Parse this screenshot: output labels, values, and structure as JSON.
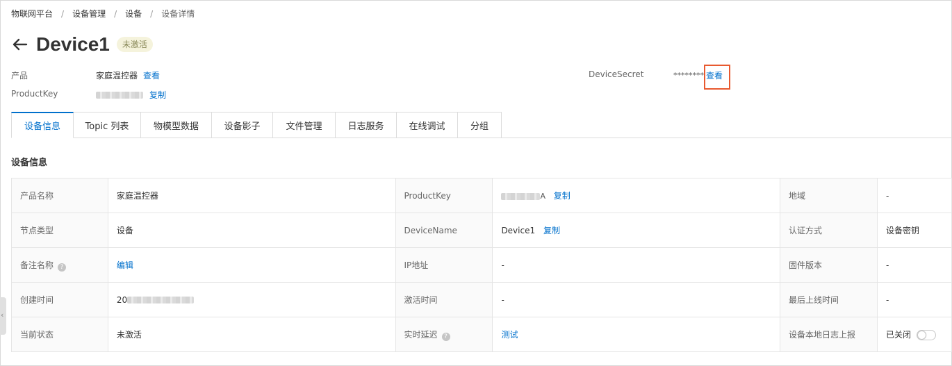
{
  "breadcrumb": [
    "物联网平台",
    "设备管理",
    "设备",
    "设备详情"
  ],
  "breadcrumb_sep": "/",
  "device": {
    "name": "Device1",
    "status_badge": "未激活"
  },
  "meta": {
    "product_label": "产品",
    "product_value": "家庭温控器",
    "product_view": "查看",
    "productkey_label": "ProductKey",
    "productkey_copy": "复制",
    "secret_label": "DeviceSecret",
    "secret_value": "********",
    "secret_view": "查看"
  },
  "tabs": [
    "设备信息",
    "Topic 列表",
    "物模型数据",
    "设备影子",
    "文件管理",
    "日志服务",
    "在线调试",
    "分组"
  ],
  "section_title": "设备信息",
  "table": {
    "rows": [
      {
        "l1": "产品名称",
        "v1": "家庭温控器",
        "l2": "ProductKey",
        "v2_suffix": "A",
        "v2_link": "复制",
        "l3": "地域",
        "v3": "-"
      },
      {
        "l1": "节点类型",
        "v1": "设备",
        "l2": "DeviceName",
        "v2": "Device1",
        "v2_link": "复制",
        "l3": "认证方式",
        "v3": "设备密钥"
      },
      {
        "l1": "备注名称",
        "v1_link": "编辑",
        "l2": "IP地址",
        "v2": "-",
        "l3": "固件版本",
        "v3": "-"
      },
      {
        "l1": "创建时间",
        "v1": "20",
        "l2": "激活时间",
        "v2": "-",
        "l3": "最后上线时间",
        "v3": "-"
      },
      {
        "l1": "当前状态",
        "v1": "未激活",
        "l2": "实时延迟",
        "v2_link": "测试",
        "l3": "设备本地日志上报",
        "v3": "已关闭"
      }
    ]
  },
  "help_glyph": "?",
  "side_handle_glyph": "‹"
}
